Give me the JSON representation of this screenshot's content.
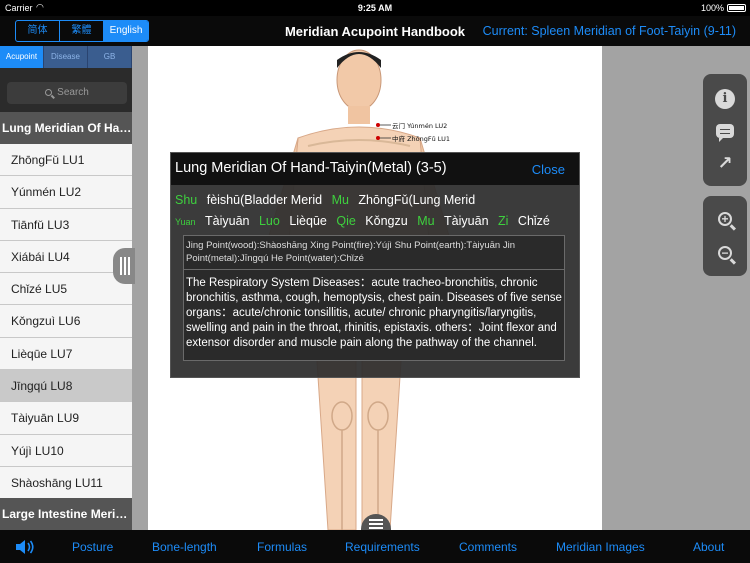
{
  "statusbar": {
    "carrier": "Carrier",
    "time": "9:25 AM",
    "battery": "100%"
  },
  "nav": {
    "languages": [
      {
        "label": "简体",
        "active": false
      },
      {
        "label": "繁體",
        "active": false
      },
      {
        "label": "English",
        "active": true
      }
    ],
    "title": "Meridian Acupoint Handbook",
    "current": "Current: Spleen Meridian of Foot-Taiyin (9-11)"
  },
  "sidebar": {
    "tabs": [
      "Acupoint",
      "Disease",
      "GB"
    ],
    "search_placeholder": "Search",
    "section_header": "Lung Meridian Of Hand-Taiyin(Metal)",
    "items": [
      "ZhōngFǔ LU1",
      "Yúnmén LU2",
      "Tiānfǔ LU3",
      "Xiábái LU4",
      "Chǐzé LU5",
      "Kǒngzuì LU6",
      "Lièqūe LU7",
      "Jīngqú LU8",
      "Tàiyuān LU9",
      "Yújì LU10",
      "Shàoshāng LU11"
    ],
    "selected_index": 7,
    "next_section_header": "Large Intestine Meridian"
  },
  "figure": {
    "labels": [
      "云门 Yúnmén LU2",
      "中府 ZhōngFǔ LU1"
    ]
  },
  "popup": {
    "title": "Lung Meridian Of Hand-Taiyin(Metal) (3-5)",
    "close": "Close",
    "row1": [
      {
        "tag": "Shu",
        "value": "fèishū(Bladder Merid"
      },
      {
        "tag": "Mu",
        "value": "ZhōngFǔ(Lung Merid"
      }
    ],
    "row2": [
      {
        "tag": "Yuan",
        "value": "Tàiyuān"
      },
      {
        "tag": "Luo",
        "value": "Lièqūe"
      },
      {
        "tag": "Qie",
        "value": "Kǒngzu"
      },
      {
        "tag": "Mu",
        "value": "Tàiyuān"
      },
      {
        "tag": "Zi",
        "value": "Chǐzé"
      }
    ],
    "points": "Jing Point(wood):Shàoshāng  Xing Point(fire):Yújì  Shu Point(earth):Tàiyuān  Jin Point(metal):Jīngqú  He Point(water):Chǐzé",
    "description": "The Respiratory System Diseases：acute tracheo-bronchitis, chronic bronchitis, asthma, cough, hemoptysis, chest pain. Diseases of five sense organs：acute/chronic tonsillitis, acute/ chronic pharyngitis/laryngitis, swelling and pain in the throat, rhinitis, epistaxis. others：Joint flexor and extensor disorder and muscle pain along the pathway of the channel."
  },
  "toolbar": {
    "sound": "speaker-icon",
    "items": [
      "Posture",
      "Bone-length",
      "Formulas",
      "Requirements",
      "Comments",
      "Meridian Images",
      "About"
    ]
  },
  "colors": {
    "accent": "#1d8cf8",
    "green": "#3ed03e",
    "sidebar_bg": "#e6e6e6",
    "header_bg": "#555555"
  }
}
